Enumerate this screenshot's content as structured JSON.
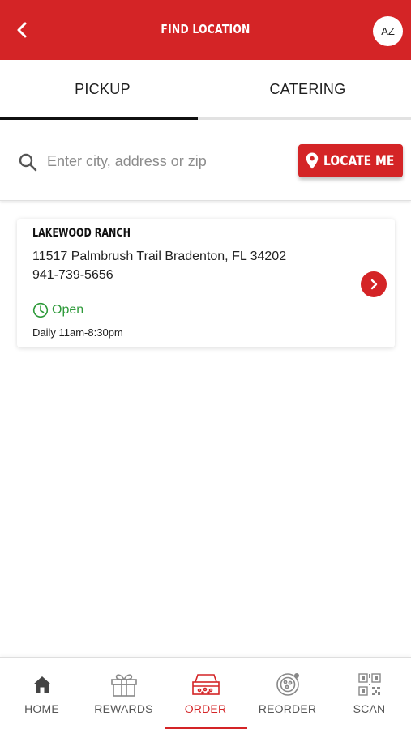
{
  "header": {
    "title": "FIND LOCATION",
    "avatar_initials": "AZ",
    "back_icon": "chevron-left-icon"
  },
  "tabs": [
    {
      "label": "PICKUP",
      "active": true
    },
    {
      "label": "CATERING",
      "active": false
    }
  ],
  "search": {
    "placeholder": "Enter city, address or zip",
    "value": "",
    "locate_label": "LOCATE ME"
  },
  "location": {
    "name": "LAKEWOOD RANCH",
    "address": "11517 Palmbrush Trail Bradenton, FL 34202",
    "phone": "941-739-5656",
    "status": "Open",
    "hours": "Daily 11am-8:30pm"
  },
  "bottom_nav": [
    {
      "label": "HOME",
      "icon": "home-icon",
      "active": false
    },
    {
      "label": "REWARDS",
      "icon": "gift-icon",
      "active": false
    },
    {
      "label": "ORDER",
      "icon": "pizza-box-icon",
      "active": true
    },
    {
      "label": "REORDER",
      "icon": "pizza-icon",
      "active": false
    },
    {
      "label": "SCAN",
      "icon": "qr-code-icon",
      "active": false
    }
  ],
  "colors": {
    "brand_red": "#d42426",
    "open_green": "#2e9a3a",
    "tab_indicator": "#111111"
  }
}
